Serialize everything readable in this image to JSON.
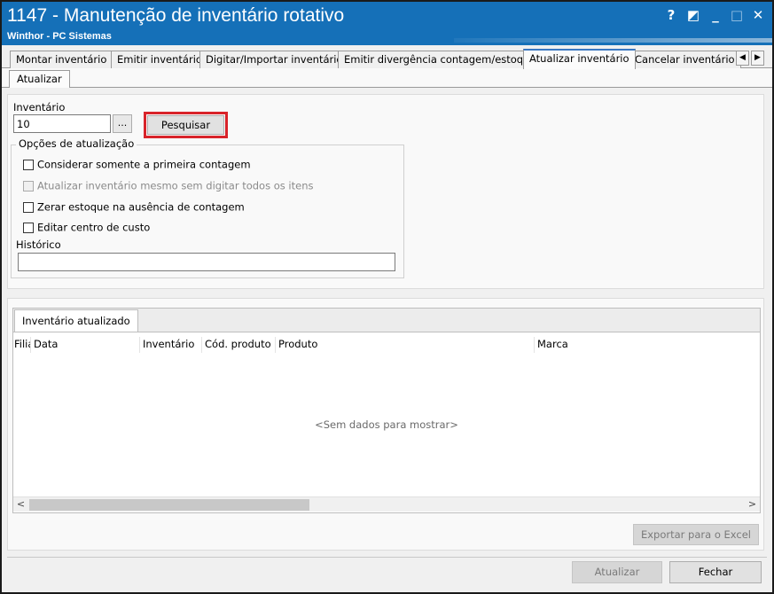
{
  "window": {
    "title": "1147 - Manutenção de inventário rotativo",
    "subtitle": "Winthor - PC Sistemas",
    "controls": {
      "help": "?",
      "restore": "◩",
      "minimize": "_",
      "maximize": "□",
      "close": "✕"
    }
  },
  "tabs": [
    {
      "label": "Montar inventário"
    },
    {
      "label": "Emitir inventário"
    },
    {
      "label": "Digitar/Importar inventário"
    },
    {
      "label": "Emitir divergência contagem/estoque"
    },
    {
      "label": "Atualizar inventário",
      "active": true
    },
    {
      "label": "Cancelar inventário"
    }
  ],
  "tab_scroll": {
    "left": "◀",
    "right": "▶"
  },
  "subtab": {
    "label": "Atualizar"
  },
  "form": {
    "inventario_label": "Inventário",
    "inventario_value": "10",
    "ellipsis_label": "...",
    "pesquisar_label": "Pesquisar",
    "opcoes_title": "Opções de atualização",
    "options": [
      {
        "label": "Considerar somente a primeira contagem",
        "enabled": true,
        "checked": false
      },
      {
        "label": "Atualizar inventário mesmo sem digitar todos os itens",
        "enabled": false,
        "checked": false
      },
      {
        "label": "Zerar estoque na ausência de contagem",
        "enabled": true,
        "checked": false
      },
      {
        "label": "Editar centro de custo",
        "enabled": true,
        "checked": false
      }
    ],
    "historico_label": "Histórico",
    "historico_value": ""
  },
  "results": {
    "tab_label": "Inventário atualizado",
    "columns": [
      "Filial",
      "Data",
      "Inventário",
      "Cód. produto",
      "Produto",
      "Marca"
    ],
    "empty_text": "<Sem dados para mostrar>",
    "scroll_left": "<",
    "scroll_right": ">",
    "export_label": "Exportar para o Excel"
  },
  "footer": {
    "atualizar_label": "Atualizar",
    "fechar_label": "Fechar"
  },
  "colors": {
    "titlebar": "#1570b8",
    "highlight": "#d8232a",
    "active_tab_accent": "#3b78c2"
  }
}
